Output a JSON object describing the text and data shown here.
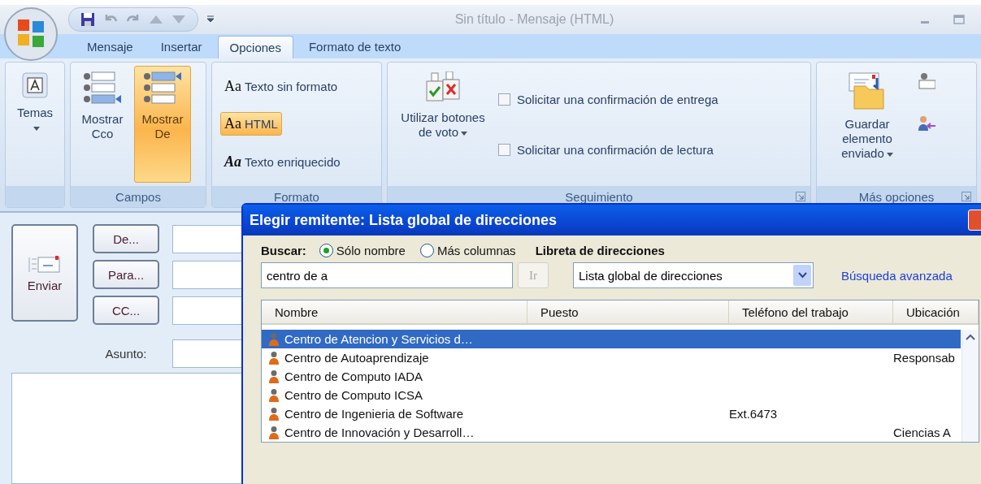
{
  "window": {
    "title": "Sin título - Mensaje (HTML)"
  },
  "tabs": [
    {
      "label": "Mensaje",
      "selected": false
    },
    {
      "label": "Insertar",
      "selected": false
    },
    {
      "label": "Opciones",
      "selected": true
    },
    {
      "label": "Formato de texto",
      "selected": false
    }
  ],
  "ribbon": {
    "groups": [
      {
        "kind": "buttons",
        "buttons": [
          {
            "kind": "themes",
            "label": "Temas",
            "selected": false,
            "dropdown": true
          }
        ]
      },
      {
        "kind": "buttons",
        "label": "Campos",
        "buttons": [
          {
            "kind": "fields-bcc",
            "label": "Mostrar Cco",
            "selected": false
          },
          {
            "kind": "fields-from",
            "label": "Mostrar De",
            "selected": true
          }
        ]
      },
      {
        "kind": "formats",
        "label": "Formato",
        "options": [
          {
            "prefix": "Aa",
            "label": "Texto sin formato",
            "selected": false
          },
          {
            "prefix": "Aa",
            "label": "HTML",
            "selected": true
          },
          {
            "prefix": "Aa",
            "label": "Texto enriquecido",
            "selected": false
          }
        ]
      },
      {
        "kind": "tracking",
        "label": "Seguimiento",
        "launcher": true,
        "buttons": [
          {
            "kind": "vote",
            "label": "Utilizar botones de voto",
            "selected": false,
            "dropdown": true
          }
        ],
        "checkboxes": [
          {
            "label": "Solicitar una confirmación de entrega",
            "checked": false
          },
          {
            "label": "Solicitar una confirmación de lectura",
            "checked": false
          }
        ]
      },
      {
        "kind": "buttons",
        "label": "Más opciones",
        "launcher": true,
        "buttons": [
          {
            "kind": "save-sent",
            "label": "Guardar elemento enviado",
            "selected": false,
            "dropdown": true
          }
        ]
      }
    ]
  },
  "compose": {
    "send_button": "Enviar",
    "address_buttons": [
      "De...",
      "Para...",
      "CC..."
    ],
    "subject_label": "Asunto:"
  },
  "dialog": {
    "title": "Elegir remitente: Lista global de direcciones",
    "search_label": "Buscar:",
    "search_scope": [
      {
        "label": "Sólo nombre",
        "selected": true
      },
      {
        "label": "Más columnas",
        "selected": false
      }
    ],
    "address_book_label": "Libreta de direcciones",
    "query": "centro de a",
    "go_button": {
      "label": "Ir",
      "disabled": true
    },
    "address_book": "Lista global de direcciones",
    "advanced_search": "Búsqueda avanzada",
    "columns": [
      "Nombre",
      "Puesto",
      "Teléfono del trabajo",
      "Ubicación"
    ],
    "rows": [
      {
        "name": "Centro de Atencion y Servicios d…",
        "selected": true
      },
      {
        "name": "Centro de Autoaprendizaje",
        "location": "Responsab",
        "selected": false
      },
      {
        "name": "Centro de Computo IADA",
        "selected": false
      },
      {
        "name": "Centro de Computo ICSA",
        "selected": false
      },
      {
        "name": "Centro de Ingenieria de Software",
        "phone": "Ext.6473",
        "selected": false
      },
      {
        "name": "Centro de Innovación y Desarroll…",
        "location": "Ciencias A",
        "selected": false
      }
    ]
  }
}
